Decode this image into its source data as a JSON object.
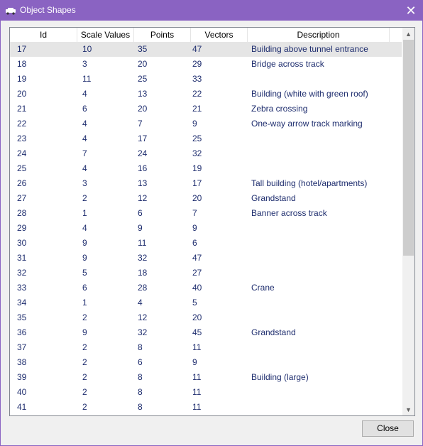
{
  "window": {
    "title": "Object Shapes",
    "icon": "car-icon",
    "close_glyph": "✕"
  },
  "table": {
    "columns": [
      "Id",
      "Scale Values",
      "Points",
      "Vectors",
      "Description"
    ],
    "selected_index": 0,
    "rows": [
      [
        "17",
        "10",
        "35",
        "47",
        "Building above tunnel entrance"
      ],
      [
        "18",
        "3",
        "20",
        "29",
        "Bridge across track"
      ],
      [
        "19",
        "11",
        "25",
        "33",
        ""
      ],
      [
        "20",
        "4",
        "13",
        "22",
        "Building (white with green roof)"
      ],
      [
        "21",
        "6",
        "20",
        "21",
        "Zebra crossing"
      ],
      [
        "22",
        "4",
        "7",
        "9",
        "One-way arrow track marking"
      ],
      [
        "23",
        "4",
        "17",
        "25",
        ""
      ],
      [
        "24",
        "7",
        "24",
        "32",
        ""
      ],
      [
        "25",
        "4",
        "16",
        "19",
        ""
      ],
      [
        "26",
        "3",
        "13",
        "17",
        "Tall building (hotel/apartments)"
      ],
      [
        "27",
        "2",
        "12",
        "20",
        "Grandstand"
      ],
      [
        "28",
        "1",
        "6",
        "7",
        "Banner across track"
      ],
      [
        "29",
        "4",
        "9",
        "9",
        ""
      ],
      [
        "30",
        "9",
        "11",
        "6",
        ""
      ],
      [
        "31",
        "9",
        "32",
        "47",
        ""
      ],
      [
        "32",
        "5",
        "18",
        "27",
        ""
      ],
      [
        "33",
        "6",
        "28",
        "40",
        "Crane"
      ],
      [
        "34",
        "1",
        "4",
        "5",
        ""
      ],
      [
        "35",
        "2",
        "12",
        "20",
        ""
      ],
      [
        "36",
        "9",
        "32",
        "45",
        "Grandstand"
      ],
      [
        "37",
        "2",
        "8",
        "11",
        ""
      ],
      [
        "38",
        "2",
        "6",
        "9",
        ""
      ],
      [
        "39",
        "2",
        "8",
        "11",
        "Building (large)"
      ],
      [
        "40",
        "2",
        "8",
        "11",
        ""
      ],
      [
        "41",
        "2",
        "8",
        "11",
        ""
      ]
    ]
  },
  "scrollbar": {
    "up_glyph": "▲",
    "down_glyph": "▼"
  },
  "buttons": {
    "close_label": "Close"
  }
}
